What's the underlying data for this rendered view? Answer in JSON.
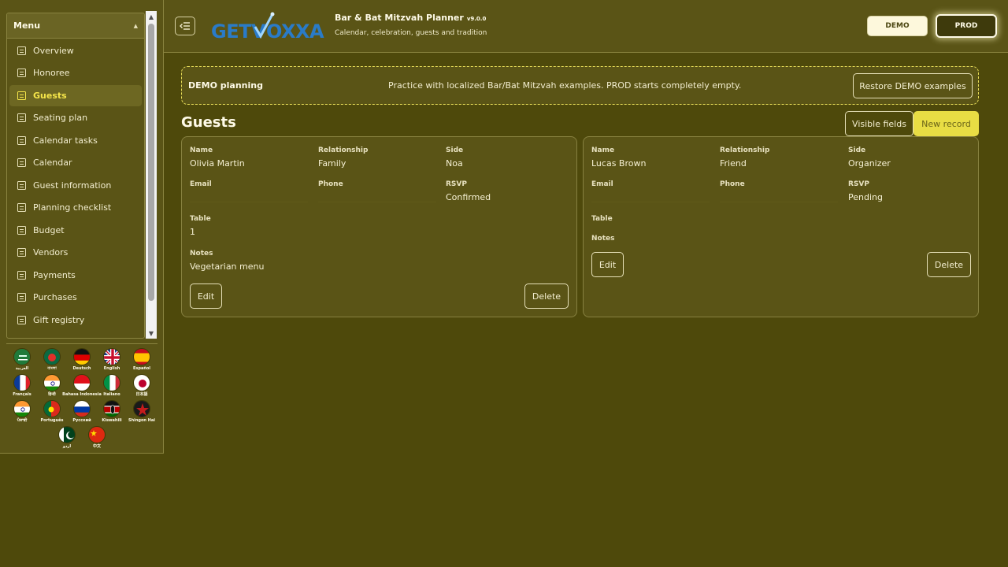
{
  "sidebar": {
    "menu_title": "Menu",
    "items": [
      {
        "label": "Overview",
        "active": false
      },
      {
        "label": "Honoree",
        "active": false
      },
      {
        "label": "Guests",
        "active": true
      },
      {
        "label": "Seating plan",
        "active": false
      },
      {
        "label": "Calendar tasks",
        "active": false
      },
      {
        "label": "Calendar",
        "active": false
      },
      {
        "label": "Guest information",
        "active": false
      },
      {
        "label": "Planning checklist",
        "active": false
      },
      {
        "label": "Budget",
        "active": false
      },
      {
        "label": "Vendors",
        "active": false
      },
      {
        "label": "Payments",
        "active": false
      },
      {
        "label": "Purchases",
        "active": false
      },
      {
        "label": "Gift registry",
        "active": false
      }
    ],
    "languages": [
      {
        "label": "العربية",
        "icon": "flag-saudi-arabia-icon"
      },
      {
        "label": "বাংলা",
        "icon": "flag-bangladesh-icon"
      },
      {
        "label": "Deutsch",
        "icon": "flag-germany-icon"
      },
      {
        "label": "English",
        "icon": "flag-uk-icon"
      },
      {
        "label": "Español",
        "icon": "flag-spain-icon"
      },
      {
        "label": "Français",
        "icon": "flag-france-icon"
      },
      {
        "label": "हिन्दी",
        "icon": "flag-india-icon"
      },
      {
        "label": "Bahasa Indonesia",
        "icon": "flag-indonesia-icon"
      },
      {
        "label": "Italiano",
        "icon": "flag-italy-icon"
      },
      {
        "label": "日本語",
        "icon": "flag-japan-icon"
      },
      {
        "label": "ਪੰਜਾਬੀ",
        "icon": "flag-india-icon"
      },
      {
        "label": "Português",
        "icon": "flag-portugal-icon"
      },
      {
        "label": "Русский",
        "icon": "flag-russia-icon"
      },
      {
        "label": "Kiswahili",
        "icon": "flag-kenya-icon"
      },
      {
        "label": "Shingon Hai",
        "icon": "flag-star-icon"
      },
      {
        "label": "اردو",
        "icon": "flag-pakistan-icon"
      },
      {
        "label": "中文",
        "icon": "flag-china-icon"
      }
    ]
  },
  "header": {
    "logo_text": "GETVOXXA",
    "app_title": "Bar & Bat Mitzvah Planner",
    "version": "v9.0.0",
    "subtitle": "Calendar, celebration, guests and tradition",
    "demo_label": "DEMO",
    "prod_label": "PROD"
  },
  "banner": {
    "title": "DEMO planning",
    "text": "Practice with localized Bar/Bat Mitzvah examples. PROD starts completely empty.",
    "restore_label": "Restore DEMO examples"
  },
  "page": {
    "title": "Guests",
    "visible_fields_label": "Visible fields",
    "new_record_label": "New record"
  },
  "labels": {
    "name": "Name",
    "relationship": "Relationship",
    "side": "Side",
    "email": "Email",
    "phone": "Phone",
    "rsvp": "RSVP",
    "table": "Table",
    "notes": "Notes",
    "edit": "Edit",
    "delete": "Delete"
  },
  "guests": [
    {
      "name": "Olivia Martin",
      "relationship": "Family",
      "side": "Noa",
      "email": "",
      "phone": "",
      "rsvp": "Confirmed",
      "table": "1",
      "notes": "Vegetarian menu"
    },
    {
      "name": "Lucas Brown",
      "relationship": "Friend",
      "side": "Organizer",
      "email": "",
      "phone": "",
      "rsvp": "Pending",
      "table": "",
      "notes": ""
    }
  ],
  "colors": {
    "background": "#4e490b",
    "panel": "#5a5416",
    "accent": "#e8dd44",
    "active_text": "#f5e54a",
    "logo_blue": "#2a7bc8"
  }
}
